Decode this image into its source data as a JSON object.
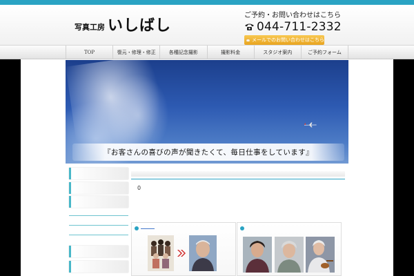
{
  "header": {
    "logo_small": "写真工房",
    "logo_main": "いしばし",
    "contact_label": "ご予約・お問い合わせはこちら",
    "phone_number": "044-711-2332",
    "mail_button_label": "メールでのお問い合わせはこちら"
  },
  "nav": {
    "items": [
      {
        "label": "TOP"
      },
      {
        "label": "復元・修理・修正"
      },
      {
        "label": "各種記念撮影"
      },
      {
        "label": "撮影料金"
      },
      {
        "label": "スタジオ案内"
      },
      {
        "label": "ご予約フォーム"
      }
    ]
  },
  "hero": {
    "slogan": "『お客さんの喜びの声が聞きたくて、毎日仕事をしています』"
  },
  "content": {
    "counter": "0"
  },
  "colors": {
    "accent": "#2aa3c3",
    "mail_button": "#f0b43a",
    "sky": "#2d5ab2"
  },
  "icons": {
    "phone": "phone-icon",
    "mail": "envelope-icon",
    "arrow": "double-chevron-right-icon"
  }
}
